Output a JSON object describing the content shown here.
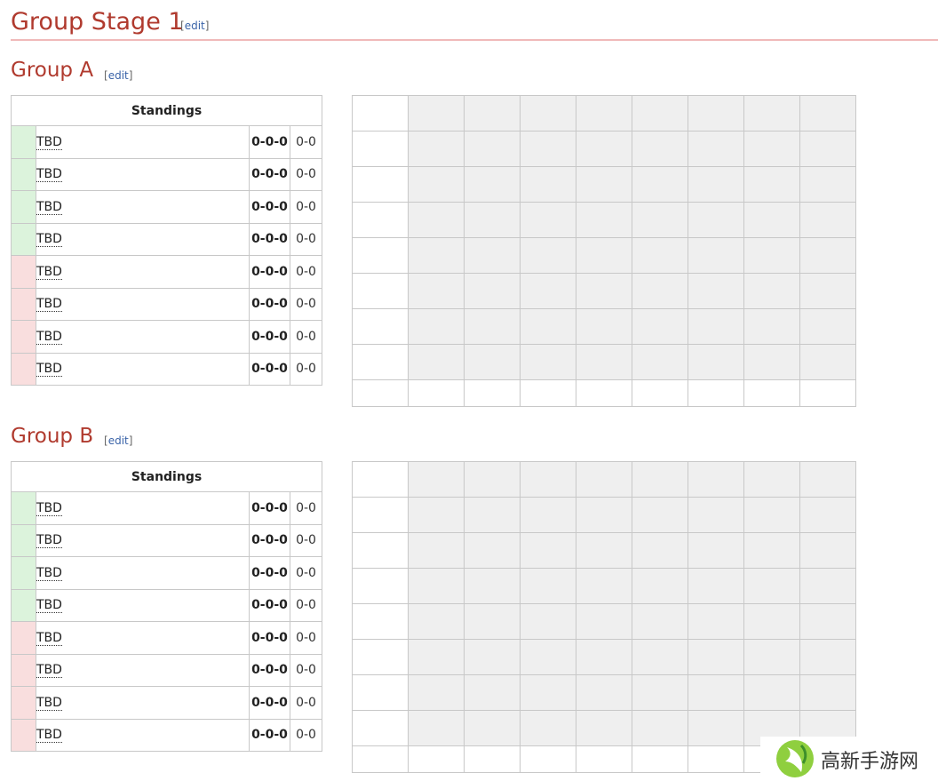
{
  "stage": {
    "title": "Group Stage 1",
    "edit_label": "edit"
  },
  "groups": [
    {
      "title": "Group A",
      "edit_label": "edit",
      "standings_header": "Standings",
      "rows": [
        {
          "status": "advance",
          "team": "TBD",
          "record": "0-0-0",
          "games": "0-0"
        },
        {
          "status": "advance",
          "team": "TBD",
          "record": "0-0-0",
          "games": "0-0"
        },
        {
          "status": "advance",
          "team": "TBD",
          "record": "0-0-0",
          "games": "0-0"
        },
        {
          "status": "advance",
          "team": "TBD",
          "record": "0-0-0",
          "games": "0-0"
        },
        {
          "status": "eliminated",
          "team": "TBD",
          "record": "0-0-0",
          "games": "0-0"
        },
        {
          "status": "eliminated",
          "team": "TBD",
          "record": "0-0-0",
          "games": "0-0"
        },
        {
          "status": "eliminated",
          "team": "TBD",
          "record": "0-0-0",
          "games": "0-0"
        },
        {
          "status": "eliminated",
          "team": "TBD",
          "record": "0-0-0",
          "games": "0-0"
        }
      ]
    },
    {
      "title": "Group B",
      "edit_label": "edit",
      "standings_header": "Standings",
      "rows": [
        {
          "status": "advance",
          "team": "TBD",
          "record": "0-0-0",
          "games": "0-0"
        },
        {
          "status": "advance",
          "team": "TBD",
          "record": "0-0-0",
          "games": "0-0"
        },
        {
          "status": "advance",
          "team": "TBD",
          "record": "0-0-0",
          "games": "0-0"
        },
        {
          "status": "advance",
          "team": "TBD",
          "record": "0-0-0",
          "games": "0-0"
        },
        {
          "status": "eliminated",
          "team": "TBD",
          "record": "0-0-0",
          "games": "0-0"
        },
        {
          "status": "eliminated",
          "team": "TBD",
          "record": "0-0-0",
          "games": "0-0"
        },
        {
          "status": "eliminated",
          "team": "TBD",
          "record": "0-0-0",
          "games": "0-0"
        },
        {
          "status": "eliminated",
          "team": "TBD",
          "record": "0-0-0",
          "games": "0-0"
        }
      ]
    }
  ],
  "colors": {
    "heading": "#b03a2e",
    "advance": "#dcf3dc",
    "eliminated": "#f9dede",
    "matrix_cell": "#efefef",
    "link": "#3a63a8"
  },
  "watermark": {
    "text": "高新手游网",
    "icon": "leaf-logo-icon"
  }
}
